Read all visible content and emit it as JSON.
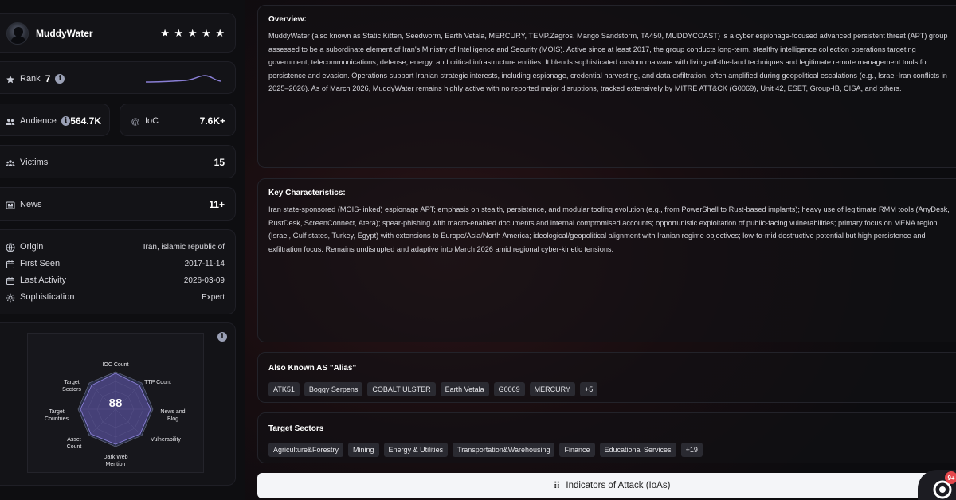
{
  "actor": {
    "name": "MuddyWater",
    "stars": "★ ★ ★ ★ ★"
  },
  "stats": {
    "rank_label": "Rank",
    "rank_value": "7",
    "audience_label": "Audience",
    "audience_value": "564.7K",
    "ioc_label": "IoC",
    "ioc_value": "7.6K+",
    "victims_label": "Victims",
    "victims_value": "15",
    "news_label": "News",
    "news_value": "11+"
  },
  "details": {
    "origin_label": "Origin",
    "origin_value": "Iran, islamic republic of",
    "first_seen_label": "First Seen",
    "first_seen_value": "2017-11-14",
    "last_activity_label": "Last Activity",
    "last_activity_value": "2026-03-09",
    "sophistication_label": "Sophistication",
    "sophistication_value": "Expert"
  },
  "radar": {
    "score": "88",
    "axes": [
      {
        "label": "IOC Count"
      },
      {
        "label": "TTP Count"
      },
      {
        "label": "News and Blog"
      },
      {
        "label": "Vulnerability"
      },
      {
        "label": "Dark Web Mention"
      },
      {
        "label": "Asset Count"
      },
      {
        "label": "Target Countries"
      },
      {
        "label": "Target Sectors"
      }
    ]
  },
  "overview": {
    "title": "Overview:",
    "text": "MuddyWater (also known as Static Kitten, Seedworm, Earth Vetala, MERCURY, TEMP.Zagros, Mango Sandstorm, TA450, MUDDYCOAST) is a cyber espionage-focused advanced persistent threat (APT) group assessed to be a subordinate element of Iran's Ministry of Intelligence and Security (MOIS). Active since at least 2017, the group conducts long-term, stealthy intelligence collection operations targeting government, telecommunications, defense, energy, and critical infrastructure entities. It blends sophisticated custom malware with living-off-the-land techniques and legitimate remote management tools for persistence and evasion. Operations support Iranian strategic interests, including espionage, credential harvesting, and data exfiltration, often amplified during geopolitical escalations (e.g., Israel-Iran conflicts in 2025–2026). As of March 2026, MuddyWater remains highly active with no reported major disruptions, tracked extensively by MITRE ATT&CK (G0069), Unit 42, ESET, Group-IB, CISA, and others."
  },
  "characteristics": {
    "title": "Key Characteristics:",
    "text": "Iran state-sponsored (MOIS-linked) espionage APT; emphasis on stealth, persistence, and modular tooling evolution (e.g., from PowerShell to Rust-based implants); heavy use of legitimate RMM tools (AnyDesk, RustDesk, ScreenConnect, Atera); spear-phishing with macro-enabled documents and internal compromised accounts; opportunistic exploitation of public-facing vulnerabilities; primary focus on MENA region (Israel, Gulf states, Turkey, Egypt) with extensions to Europe/Asia/North America; ideological/geopolitical alignment with Iranian regime objectives; low-to-mid destructive potential but high persistence and exfiltration focus. Remains undisrupted and adaptive into March 2026 amid regional cyber-kinetic tensions."
  },
  "aliases": {
    "title": "Also Known AS \"Alias\"",
    "items": [
      "ATK51",
      "Boggy Serpens",
      "COBALT ULSTER",
      "Earth Vetala",
      "G0069",
      "MERCURY",
      "+5"
    ]
  },
  "sectors": {
    "title": "Target Sectors",
    "items": [
      "Agriculture&Forestry",
      "Mining",
      "Energy & Utilities",
      "Transportation&Warehousing",
      "Finance",
      "Educational Services",
      "+19"
    ]
  },
  "ioa": {
    "label": "Indicators of Attack (IoAs)"
  },
  "chat": {
    "badge": "9+"
  }
}
